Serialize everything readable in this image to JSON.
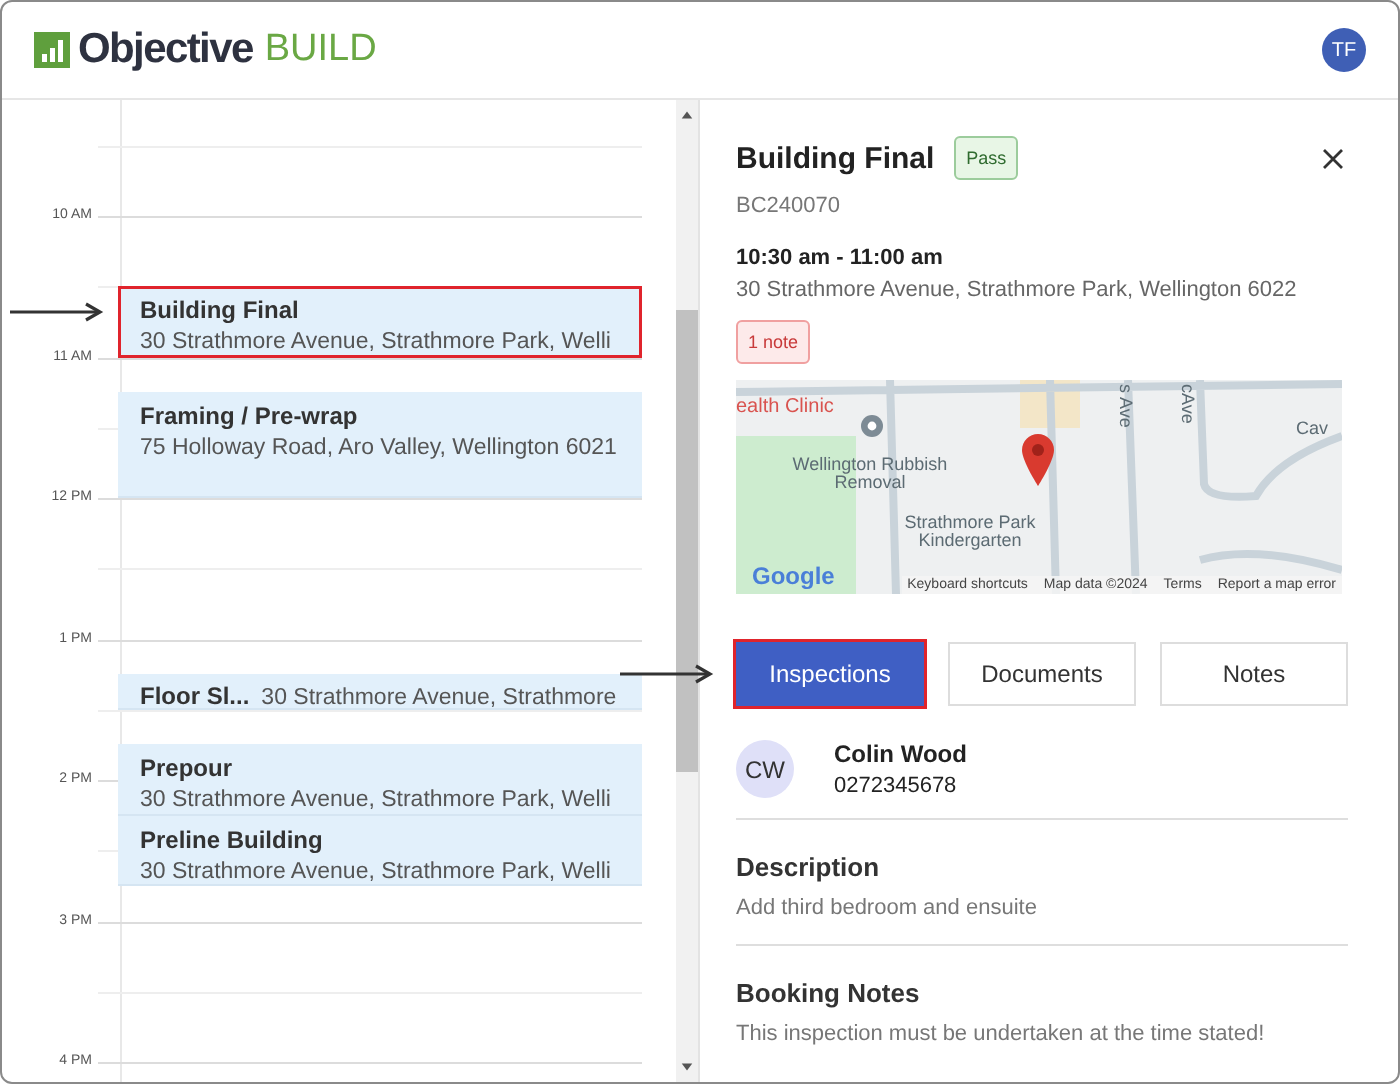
{
  "header": {
    "logo": {
      "word": "Objective",
      "product": "BUILD"
    },
    "user_initials": "TF"
  },
  "calendar": {
    "hours": [
      "10 AM",
      "11 AM",
      "12 PM",
      "1 PM",
      "2 PM",
      "3 PM",
      "4 PM"
    ],
    "events": [
      {
        "title": "Building Final",
        "address": "30 Strathmore Avenue, Strathmore Park, Welli",
        "highlighted": true
      },
      {
        "title": "Framing / Pre-wrap",
        "address": "75 Holloway Road, Aro Valley, Wellington 6021",
        "highlighted": false
      },
      {
        "title": "Floor Sl...",
        "address": "30 Strathmore Avenue, Strathmore",
        "highlighted": false
      },
      {
        "title": "Prepour",
        "address": "30 Strathmore Avenue, Strathmore Park, Welli",
        "highlighted": false
      },
      {
        "title": "Preline Building",
        "address": "30 Strathmore Avenue, Strathmore Park, Welli",
        "highlighted": false
      }
    ]
  },
  "detail": {
    "title": "Building Final",
    "status": "Pass",
    "reference": "BC240070",
    "time": "10:30 am - 11:00 am",
    "address": "30 Strathmore Avenue, Strathmore Park, Wellington 6022",
    "notes_badge": "1 note",
    "map": {
      "labels": [
        "ealth Clinic",
        "Wellington Rubbish Removal",
        "Strathmore Park Kindergarten",
        "s Ave",
        "cAve",
        "Cav"
      ],
      "logo": "Google",
      "attribution": [
        "Keyboard shortcuts",
        "Map data ©2024",
        "Terms",
        "Report a map error"
      ]
    },
    "tabs": [
      {
        "label": "Inspections",
        "selected": true,
        "highlighted": true
      },
      {
        "label": "Documents",
        "selected": false,
        "highlighted": false
      },
      {
        "label": "Notes",
        "selected": false,
        "highlighted": false
      }
    ],
    "contact": {
      "initials": "CW",
      "name": "Colin Wood",
      "phone": "0272345678"
    },
    "sections": [
      {
        "heading": "Description",
        "text": "Add third bedroom and ensuite"
      },
      {
        "heading": "Booking Notes",
        "text": "This inspection must be undertaken at the time stated!"
      }
    ]
  }
}
